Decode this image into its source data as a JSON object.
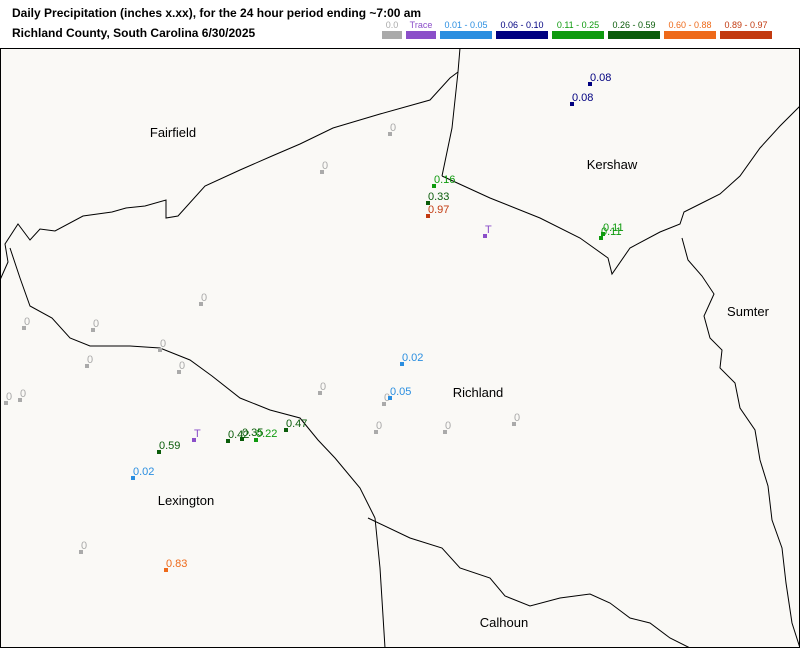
{
  "header": {
    "title": "Daily Precipitation (inches  x.xx),  for the 24 hour period ending ~7:00 am",
    "subtitle": "Richland County, South Carolina  6/30/2025"
  },
  "legend": [
    {
      "label": "0.0",
      "color": "#aaaaaa"
    },
    {
      "label": "Trace",
      "color": "#8b4fc9"
    },
    {
      "label": "0.01 - 0.05",
      "color": "#2a8ee0"
    },
    {
      "label": "0.06 - 0.10",
      "color": "#000080"
    },
    {
      "label": "0.11 - 0.25",
      "color": "#0e9a0e"
    },
    {
      "label": "0.26 - 0.59",
      "color": "#0a5c0a"
    },
    {
      "label": "0.60 - 0.88",
      "color": "#ee6a1a"
    },
    {
      "label": "0.89 - 0.97",
      "color": "#c23a10"
    }
  ],
  "counties": [
    {
      "name": "Fairfield"
    },
    {
      "name": "Kershaw"
    },
    {
      "name": "Sumter"
    },
    {
      "name": "Richland"
    },
    {
      "name": "Lexington"
    },
    {
      "name": "Calhoun"
    }
  ],
  "stations": [
    {
      "label": "0.08",
      "color": "#000080"
    },
    {
      "label": "0.08",
      "color": "#000080"
    },
    {
      "label": "0",
      "color": "#aaaaaa"
    },
    {
      "label": "0",
      "color": "#aaaaaa"
    },
    {
      "label": "0.16",
      "color": "#0e9a0e"
    },
    {
      "label": "0.33",
      "color": "#0a5c0a"
    },
    {
      "label": "0.97",
      "color": "#c23a10"
    },
    {
      "label": "T",
      "color": "#8b4fc9"
    },
    {
      "label": "0.11",
      "color": "#0e9a0e"
    },
    {
      "label": "0.11",
      "color": "#0e9a0e"
    },
    {
      "label": "0",
      "color": "#aaaaaa"
    },
    {
      "label": "0",
      "color": "#aaaaaa"
    },
    {
      "label": "0",
      "color": "#aaaaaa"
    },
    {
      "label": "0",
      "color": "#aaaaaa"
    },
    {
      "label": "0",
      "color": "#aaaaaa"
    },
    {
      "label": "0",
      "color": "#aaaaaa"
    },
    {
      "label": "0",
      "color": "#aaaaaa"
    },
    {
      "label": "0.02",
      "color": "#2a8ee0"
    },
    {
      "label": "0",
      "color": "#aaaaaa"
    },
    {
      "label": "0.05",
      "color": "#2a8ee0"
    },
    {
      "label": "0",
      "color": "#aaaaaa"
    },
    {
      "label": "0",
      "color": "#aaaaaa"
    },
    {
      "label": "0",
      "color": "#aaaaaa"
    },
    {
      "label": "0",
      "color": "#aaaaaa"
    },
    {
      "label": "0",
      "color": "#aaaaaa"
    },
    {
      "label": "T",
      "color": "#8b4fc9"
    },
    {
      "label": "0.59",
      "color": "#0a5c0a"
    },
    {
      "label": "0.42",
      "color": "#0a5c0a"
    },
    {
      "label": "0.35",
      "color": "#0a5c0a"
    },
    {
      "label": "0.22",
      "color": "#0e9a0e"
    },
    {
      "label": "0.47",
      "color": "#0a5c0a"
    },
    {
      "label": "0.02",
      "color": "#2a8ee0"
    },
    {
      "label": "0",
      "color": "#aaaaaa"
    },
    {
      "label": "0.83",
      "color": "#ee6a1a"
    }
  ]
}
